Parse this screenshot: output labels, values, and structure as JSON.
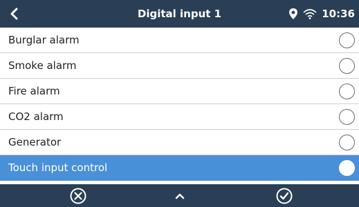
{
  "header": {
    "title": "Digital input 1",
    "time": "10:36",
    "back_icon": "chevron-left-icon",
    "location_icon": "location-pin-icon",
    "wifi_icon": "wifi-icon"
  },
  "options": [
    {
      "label": "Burglar alarm",
      "selected": false
    },
    {
      "label": "Smoke alarm",
      "selected": false
    },
    {
      "label": "Fire alarm",
      "selected": false
    },
    {
      "label": "CO2 alarm",
      "selected": false
    },
    {
      "label": "Generator",
      "selected": false
    },
    {
      "label": "Touch input control",
      "selected": true
    }
  ],
  "footer": {
    "cancel_icon": "cancel-circle-icon",
    "up_icon": "chevron-up-icon",
    "confirm_icon": "check-circle-icon"
  },
  "colors": {
    "header_bg": "#2a3f55",
    "selected_bg": "#4a90d9",
    "text": "#222222"
  }
}
